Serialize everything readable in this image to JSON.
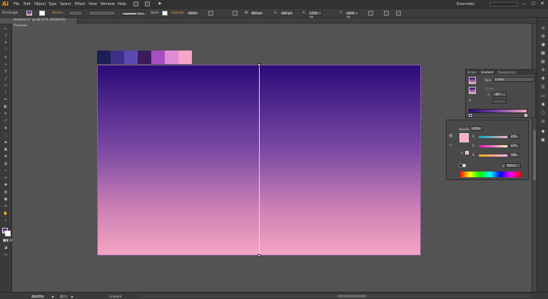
{
  "app": {
    "logo": "Ai",
    "workspace": "Essentials"
  },
  "menu": [
    "File",
    "Edit",
    "Object",
    "Type",
    "Select",
    "Effect",
    "View",
    "Window",
    "Help"
  ],
  "control": {
    "tool_name": "Rectangle",
    "stroke_label": "Stroke:",
    "basic_label": "Basic",
    "style_label": "Style:",
    "opacity_label": "Opacity:",
    "opacity_value": "100%",
    "w_value": "800 px",
    "h_value": "600 px",
    "x_value": "1700 px",
    "y_value": "1000 px"
  },
  "document_tab": "Untitled-1* @ 66.67% (RGB/GPU Preview)",
  "swatches": [
    "#1b1f55",
    "#3f2e86",
    "#5a4ab0",
    "#3f1a5a",
    "#a64fc0",
    "#e08ad8",
    "#f6a6c6"
  ],
  "gradient_panel": {
    "tabs": [
      "Stroke",
      "Gradient",
      "Transparency"
    ],
    "type_label": "Type:",
    "type_value": "Linear",
    "stroke_label": "Stroke:",
    "angle_value": "-90°"
  },
  "color_panel": {
    "opacity_label": "Opacity:",
    "opacity_value": "100%",
    "r_label": "R",
    "g_label": "G",
    "b_label": "B",
    "r_value": "255",
    "g_value": "175",
    "b_value": "195",
    "hex_value": "ffafc3"
  },
  "status": {
    "zoom": "66.67%",
    "page": "1",
    "tool": "Gradient"
  }
}
